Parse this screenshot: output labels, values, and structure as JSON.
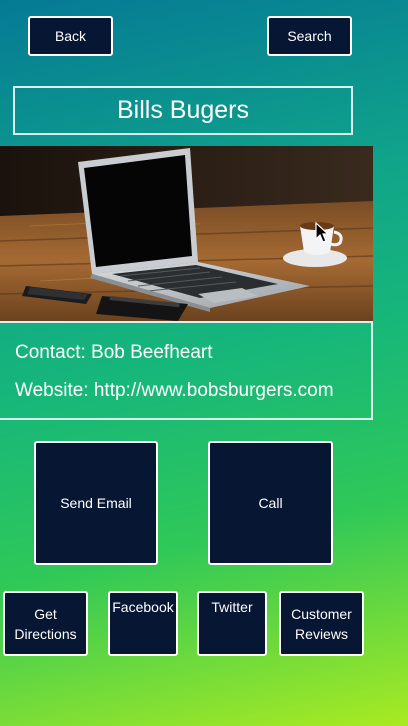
{
  "nav": {
    "back_label": "Back",
    "search_label": "Search"
  },
  "business": {
    "name": "Bills Bugers"
  },
  "info": {
    "contact": "Contact: Bob Beefheart",
    "website": "Website: http://www.bobsburgers.com"
  },
  "actions": {
    "send_email": "Send Email",
    "call": "Call",
    "get_directions": "Get Directions",
    "facebook": "Facebook",
    "twitter": "Twitter",
    "customer_reviews": "Customer Reviews"
  },
  "image": {
    "icon": "laptop-on-desk-photo"
  },
  "colors": {
    "button_bg": "#061633",
    "border": "#ffffff"
  }
}
